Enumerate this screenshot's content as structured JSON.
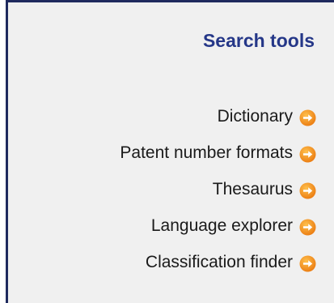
{
  "panel": {
    "title": "Search tools",
    "items": [
      {
        "label": "Dictionary",
        "icon": "arrow-right-circle-icon"
      },
      {
        "label": "Patent number formats",
        "icon": "arrow-right-circle-icon"
      },
      {
        "label": "Thesaurus",
        "icon": "arrow-right-circle-icon"
      },
      {
        "label": "Language explorer",
        "icon": "arrow-right-circle-icon"
      },
      {
        "label": "Classification finder",
        "icon": "arrow-right-circle-icon"
      }
    ]
  },
  "colors": {
    "border": "#1f2a5e",
    "title": "#253788",
    "panel_bg": "#f0f0f0",
    "icon": "#f08a1c"
  }
}
